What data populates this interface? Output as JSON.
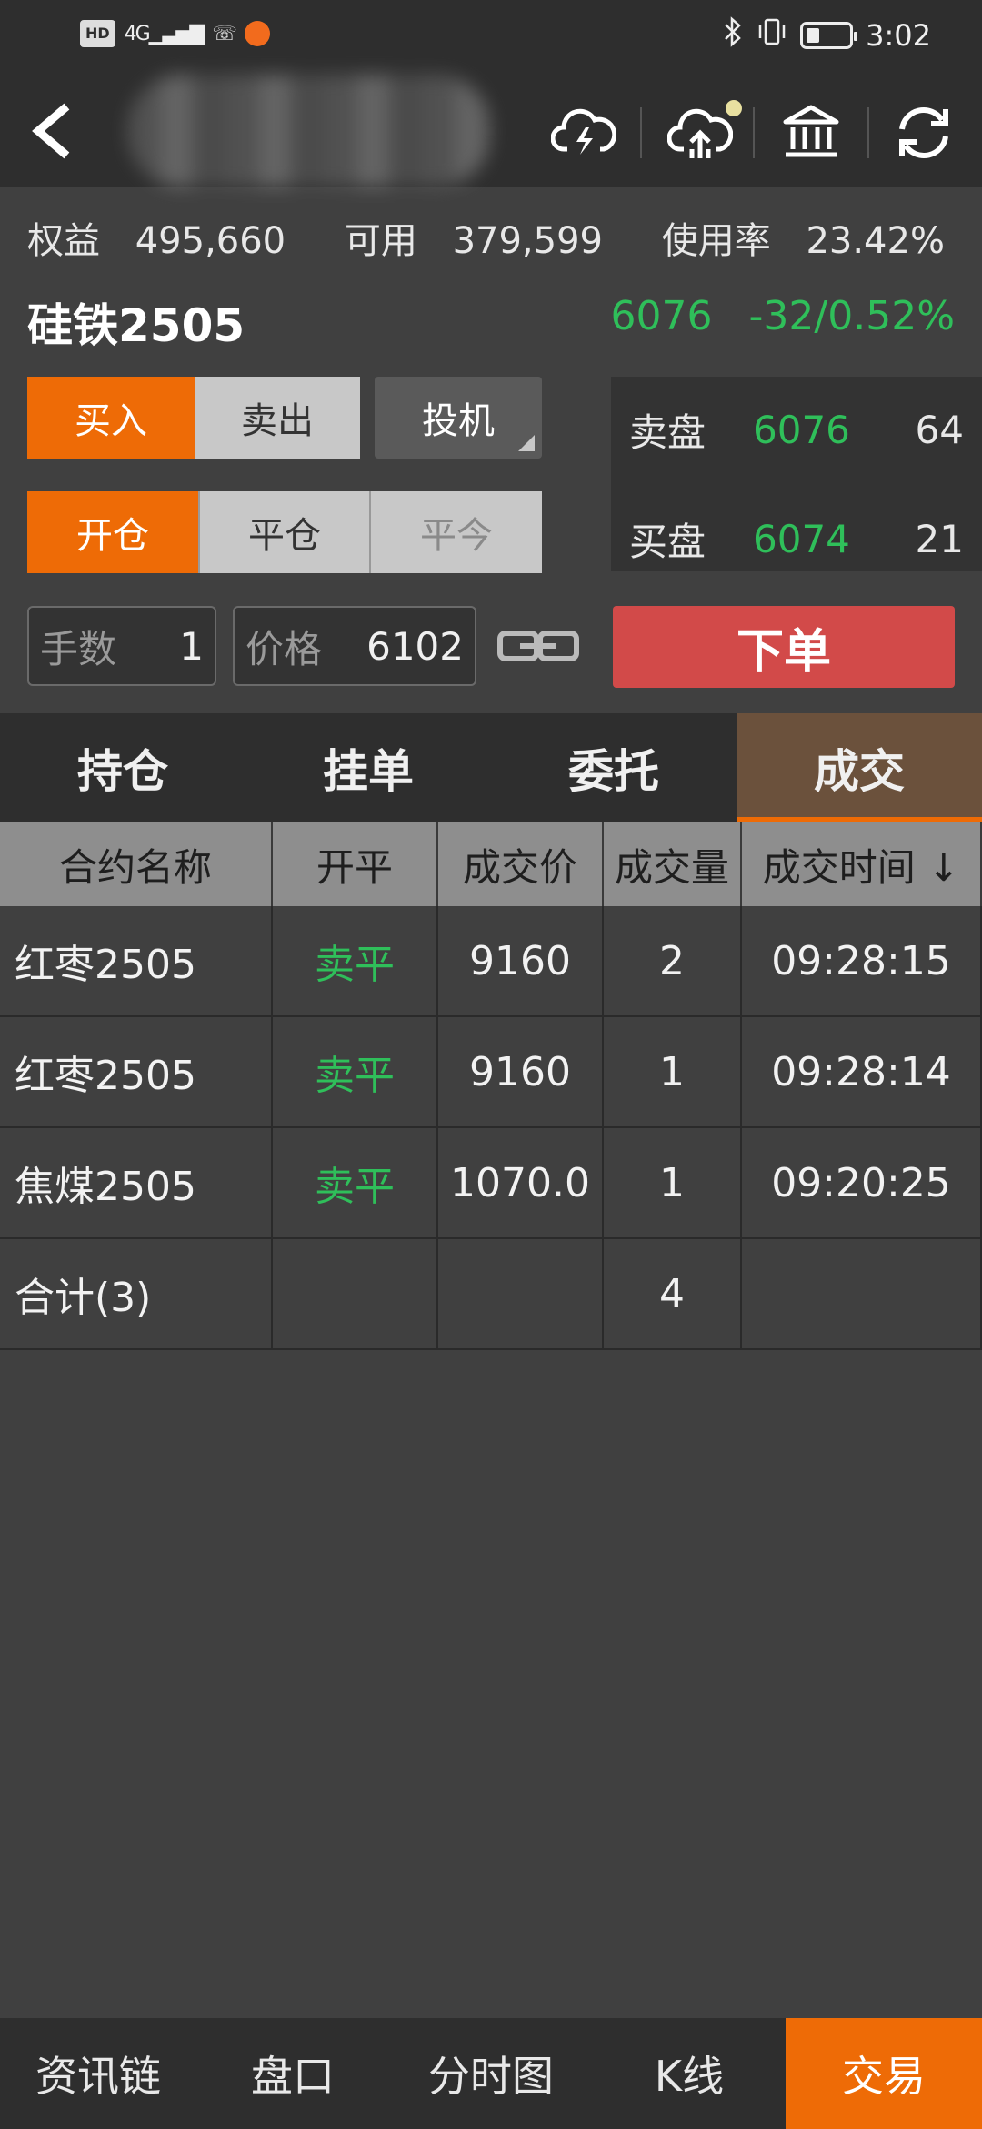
{
  "status_bar": {
    "hd": "HD",
    "signal": "4G",
    "time": "3:02"
  },
  "header": {
    "icons": [
      "back-icon",
      "cloud-lightning-icon",
      "cloud-upload-icon",
      "bank-icon",
      "refresh-icon"
    ]
  },
  "account": {
    "equity_label": "权益",
    "equity_value": "495,660",
    "available_label": "可用",
    "available_value": "379,599",
    "usage_label": "使用率",
    "usage_value": "23.42%"
  },
  "contract": {
    "name": "硅铁2505",
    "last_price": "6076",
    "change": "-32/0.52%"
  },
  "trade_panel": {
    "buy_label": "买入",
    "sell_label": "卖出",
    "speculation_label": "投机",
    "open_label": "开仓",
    "close_label": "平仓",
    "close_today_label": "平今",
    "qty_label": "手数",
    "qty_value": "1",
    "price_label": "价格",
    "price_value": "6102",
    "order_button": "下单"
  },
  "order_book": {
    "ask_label": "卖盘",
    "ask_price": "6076",
    "ask_volume": "64",
    "bid_label": "买盘",
    "bid_price": "6074",
    "bid_volume": "21"
  },
  "tabs": [
    {
      "label": "持仓"
    },
    {
      "label": "挂单"
    },
    {
      "label": "委托"
    },
    {
      "label": "成交"
    }
  ],
  "table": {
    "headers": [
      "合约名称",
      "开平",
      "成交价",
      "成交量",
      "成交时间 ↓"
    ],
    "rows": [
      {
        "name": "红枣2505",
        "side": "卖平",
        "price": "9160",
        "volume": "2",
        "time": "09:28:15"
      },
      {
        "name": "红枣2505",
        "side": "卖平",
        "price": "9160",
        "volume": "1",
        "time": "09:28:14"
      },
      {
        "name": "焦煤2505",
        "side": "卖平",
        "price": "1070.0",
        "volume": "1",
        "time": "09:20:25"
      }
    ],
    "total": {
      "name": "合计(3)",
      "volume": "4"
    }
  },
  "bottom_nav": [
    {
      "label": "资讯链"
    },
    {
      "label": "盘口"
    },
    {
      "label": "分时图"
    },
    {
      "label": "K线"
    },
    {
      "label": "交易"
    }
  ],
  "colors": {
    "accent": "#ee6b06",
    "up_down_green": "#2fbf5a",
    "order_red": "#d24a49",
    "active_tab": "#6b513c"
  }
}
